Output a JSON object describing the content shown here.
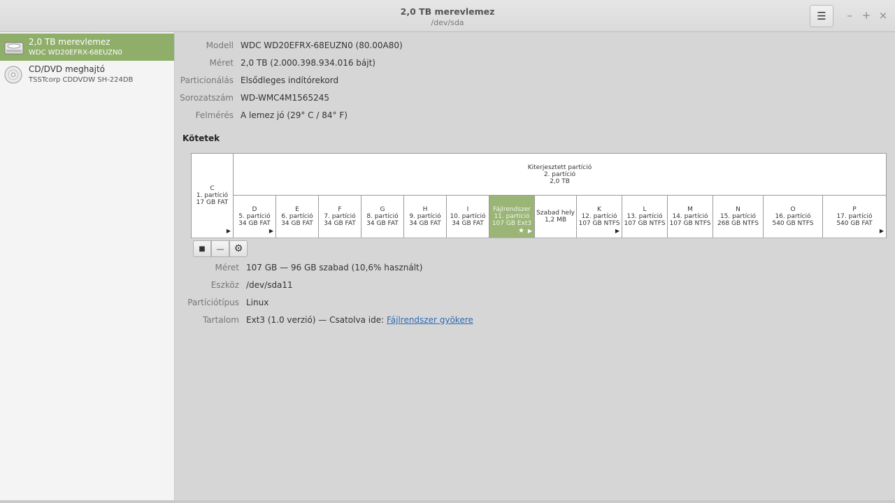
{
  "window": {
    "title": "2,0 TB merevlemez",
    "subtitle": "/dev/sda",
    "menu_icon": "☰",
    "minimize": "–",
    "maximize": "+",
    "close": "×"
  },
  "sidebar": {
    "items": [
      {
        "name": "2,0 TB merevlemez",
        "model": "WDC WD20EFRX-68EUZN0",
        "icon": "hard-disk-icon",
        "selected": true
      },
      {
        "name": "CD/DVD meghajtó",
        "model": "TSSTcorp CDDVDW SH-224DB",
        "icon": "optical-disc-icon",
        "selected": false
      }
    ]
  },
  "drive_info": [
    {
      "label": "Modell",
      "value": "WDC WD20EFRX-68EUZN0 (80.00A80)"
    },
    {
      "label": "Méret",
      "value": "2,0 TB (2.000.398.934.016 bájt)"
    },
    {
      "label": "Particionálás",
      "value": "Elsődleges indítórekord"
    },
    {
      "label": "Sorozatszám",
      "value": "WD-WMC4M1565245"
    },
    {
      "label": "Felmérés",
      "value": "A lemez jó (29° C / 84° F)"
    }
  ],
  "volumes": {
    "title": "Kötetek",
    "c_partition": {
      "letter": "C",
      "name": "1. partíció",
      "size": "17 GB FAT"
    },
    "extended": {
      "title": "Kiterjesztett partíció",
      "name": "2. partíció",
      "size": "2,0 TB"
    },
    "partitions": [
      {
        "line1": "D",
        "line2": "5. partíció",
        "line3": "34 GB FAT",
        "arrow": true
      },
      {
        "line1": "E",
        "line2": "6. partíció",
        "line3": "34 GB FAT"
      },
      {
        "line1": "F",
        "line2": "7. partíció",
        "line3": "34 GB FAT"
      },
      {
        "line1": "G",
        "line2": "8. partíció",
        "line3": "34 GB FAT"
      },
      {
        "line1": "H",
        "line2": "9. partíció",
        "line3": "34 GB FAT"
      },
      {
        "line1": "I",
        "line2": "10. partíció",
        "line3": "34 GB FAT"
      },
      {
        "line1": "Fájlrendszer",
        "line2": "11. partíció",
        "line3": "107 GB Ext3",
        "selected": true,
        "star": true,
        "arrow": true
      },
      {
        "line1": "Szabad hely",
        "line2": "1,2 MB",
        "line3": ""
      },
      {
        "line1": "K",
        "line2": "12. partíció",
        "line3": "107 GB NTFS",
        "arrow": true
      },
      {
        "line1": "L",
        "line2": "13. partíció",
        "line3": "107 GB NTFS"
      },
      {
        "line1": "M",
        "line2": "14. partíció",
        "line3": "107 GB NTFS"
      },
      {
        "line1": "N",
        "line2": "15. partíció",
        "line3": "268 GB NTFS"
      },
      {
        "line1": "O",
        "line2": "16. partíció",
        "line3": "540 GB NTFS"
      },
      {
        "line1": "P",
        "line2": "17. partíció",
        "line3": "540 GB FAT",
        "arrow": true
      }
    ],
    "toolbar": {
      "stop_icon": "■",
      "remove_icon": "—",
      "settings_icon": "⚙"
    }
  },
  "partition_details": {
    "size_label": "Méret",
    "size_value": "107 GB — 96 GB szabad (10,6% használt)",
    "device_label": "Eszköz",
    "device_value": "/dev/sda11",
    "type_label": "Partíciótípus",
    "type_value": "Linux",
    "content_label": "Tartalom",
    "content_value": "Ext3 (1.0 verzió) — Csatolva ide: ",
    "content_link": "Fájlrendszer gyökere"
  },
  "glyphs": {
    "arrow": "▶",
    "star": "★"
  }
}
